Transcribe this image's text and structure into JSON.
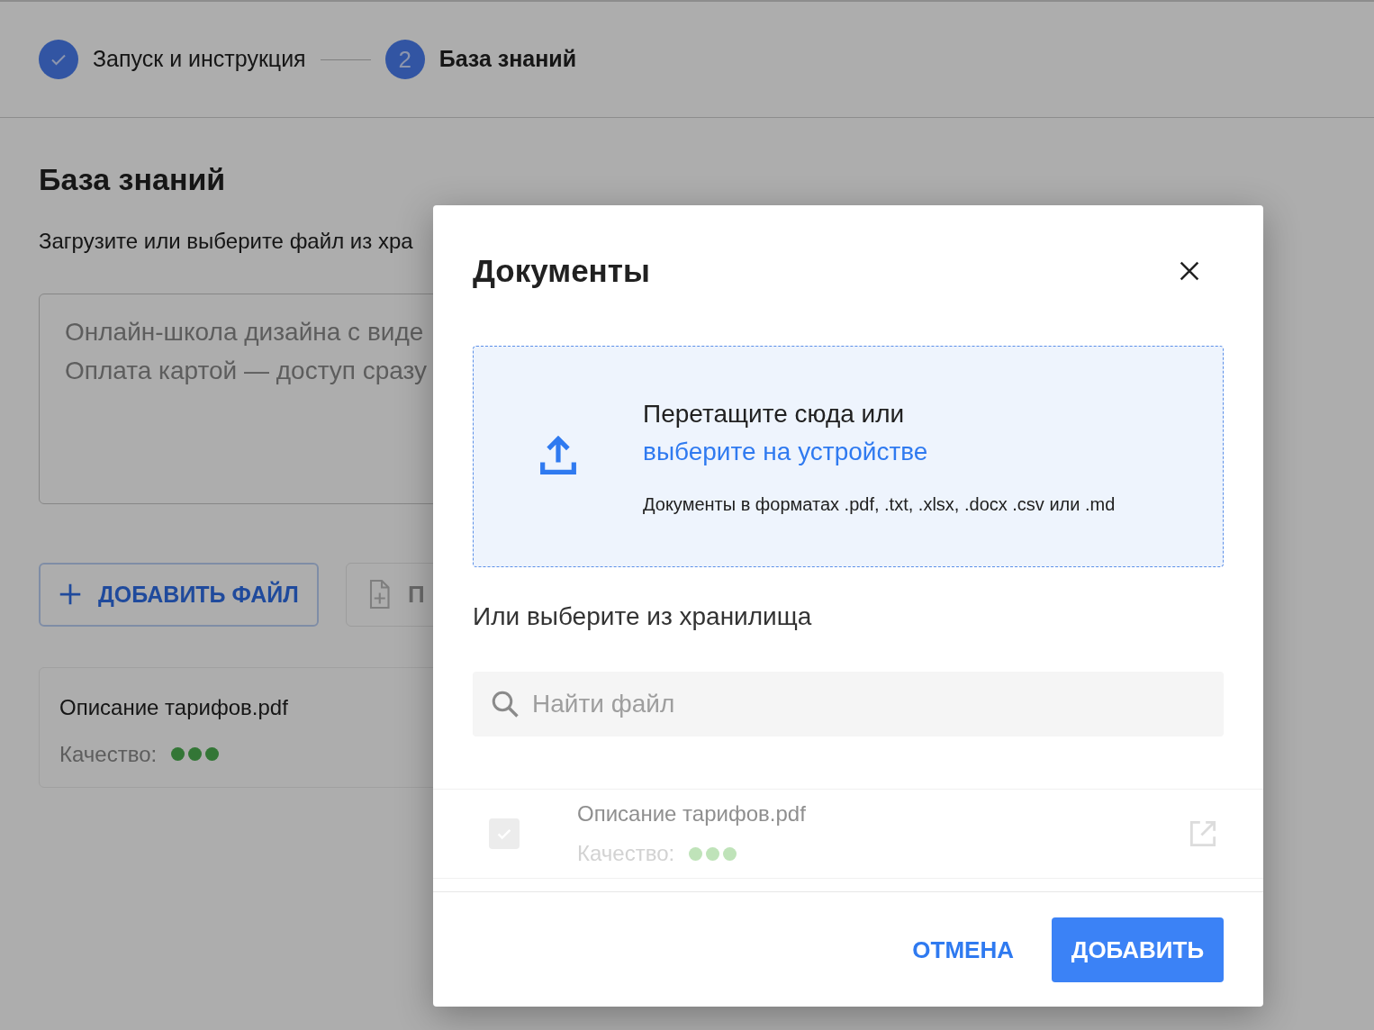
{
  "stepper": [
    {
      "label": "Запуск и инструкция",
      "kind": "done",
      "selected": false
    },
    {
      "label": "База знаний",
      "kind": "number",
      "number": "2",
      "selected": true
    }
  ],
  "page": {
    "title": "База знаний",
    "subtitle": "Загрузите или выберите файл из хра",
    "description_lines": [
      "Онлайн-школа дизайна с виде",
      "Оплата картой — доступ сразу"
    ],
    "buttons": [
      {
        "label": "ДОБАВИТЬ ФАЙЛ",
        "kind": "add"
      },
      {
        "label": "П",
        "kind": "file"
      }
    ],
    "files": [
      {
        "name": "Описание тарифов.pdf",
        "quality_label": "Качество:",
        "stars": 3
      }
    ]
  },
  "dialog": {
    "title": "Документы",
    "dropzone": {
      "text": "Перетащите сюда или",
      "link": "выберите на устройстве",
      "hint": "Документы в форматах .pdf, .txt, .xlsx, .docx .csv или .md"
    },
    "storage_title": "Или выберите из хранилища",
    "search": {
      "placeholder": "Найти файл"
    },
    "files": [
      {
        "name": "Описание тарифов.pdf",
        "quality_label": "Качество:",
        "stars": 3,
        "checked": true,
        "disabled": true
      }
    ],
    "buttons": [
      {
        "label": "ОТМЕНА",
        "kind": "text"
      },
      {
        "label": "ДОБАВИТЬ",
        "kind": "primary"
      }
    ]
  }
}
